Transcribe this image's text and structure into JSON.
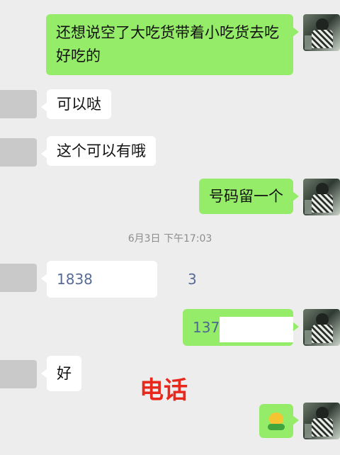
{
  "conversation": {
    "messages": [
      {
        "from": "me",
        "text": "还想说空了大吃货带着小吃货去吃好吃的"
      },
      {
        "from": "other",
        "text": "可以哒"
      },
      {
        "from": "other",
        "text": "这个可以有哦"
      },
      {
        "from": "me",
        "text": "号码留一个"
      },
      {
        "from": "system",
        "text": "6月3日 下午17:03"
      },
      {
        "from": "other",
        "text_start": "1838",
        "text_end": "3"
      },
      {
        "from": "me",
        "text_start": "1370"
      },
      {
        "from": "other",
        "text": "好"
      },
      {
        "from": "me",
        "emoji": "smiling-sprout-emoji"
      }
    ]
  },
  "overlay_label": "电话",
  "colors": {
    "background": "#ededed",
    "my_bubble": "#95ec69",
    "their_bubble": "#ffffff",
    "timestamp": "#8d8d8d",
    "phone_link": "#576b95",
    "overlay_label": "#e8281c"
  }
}
